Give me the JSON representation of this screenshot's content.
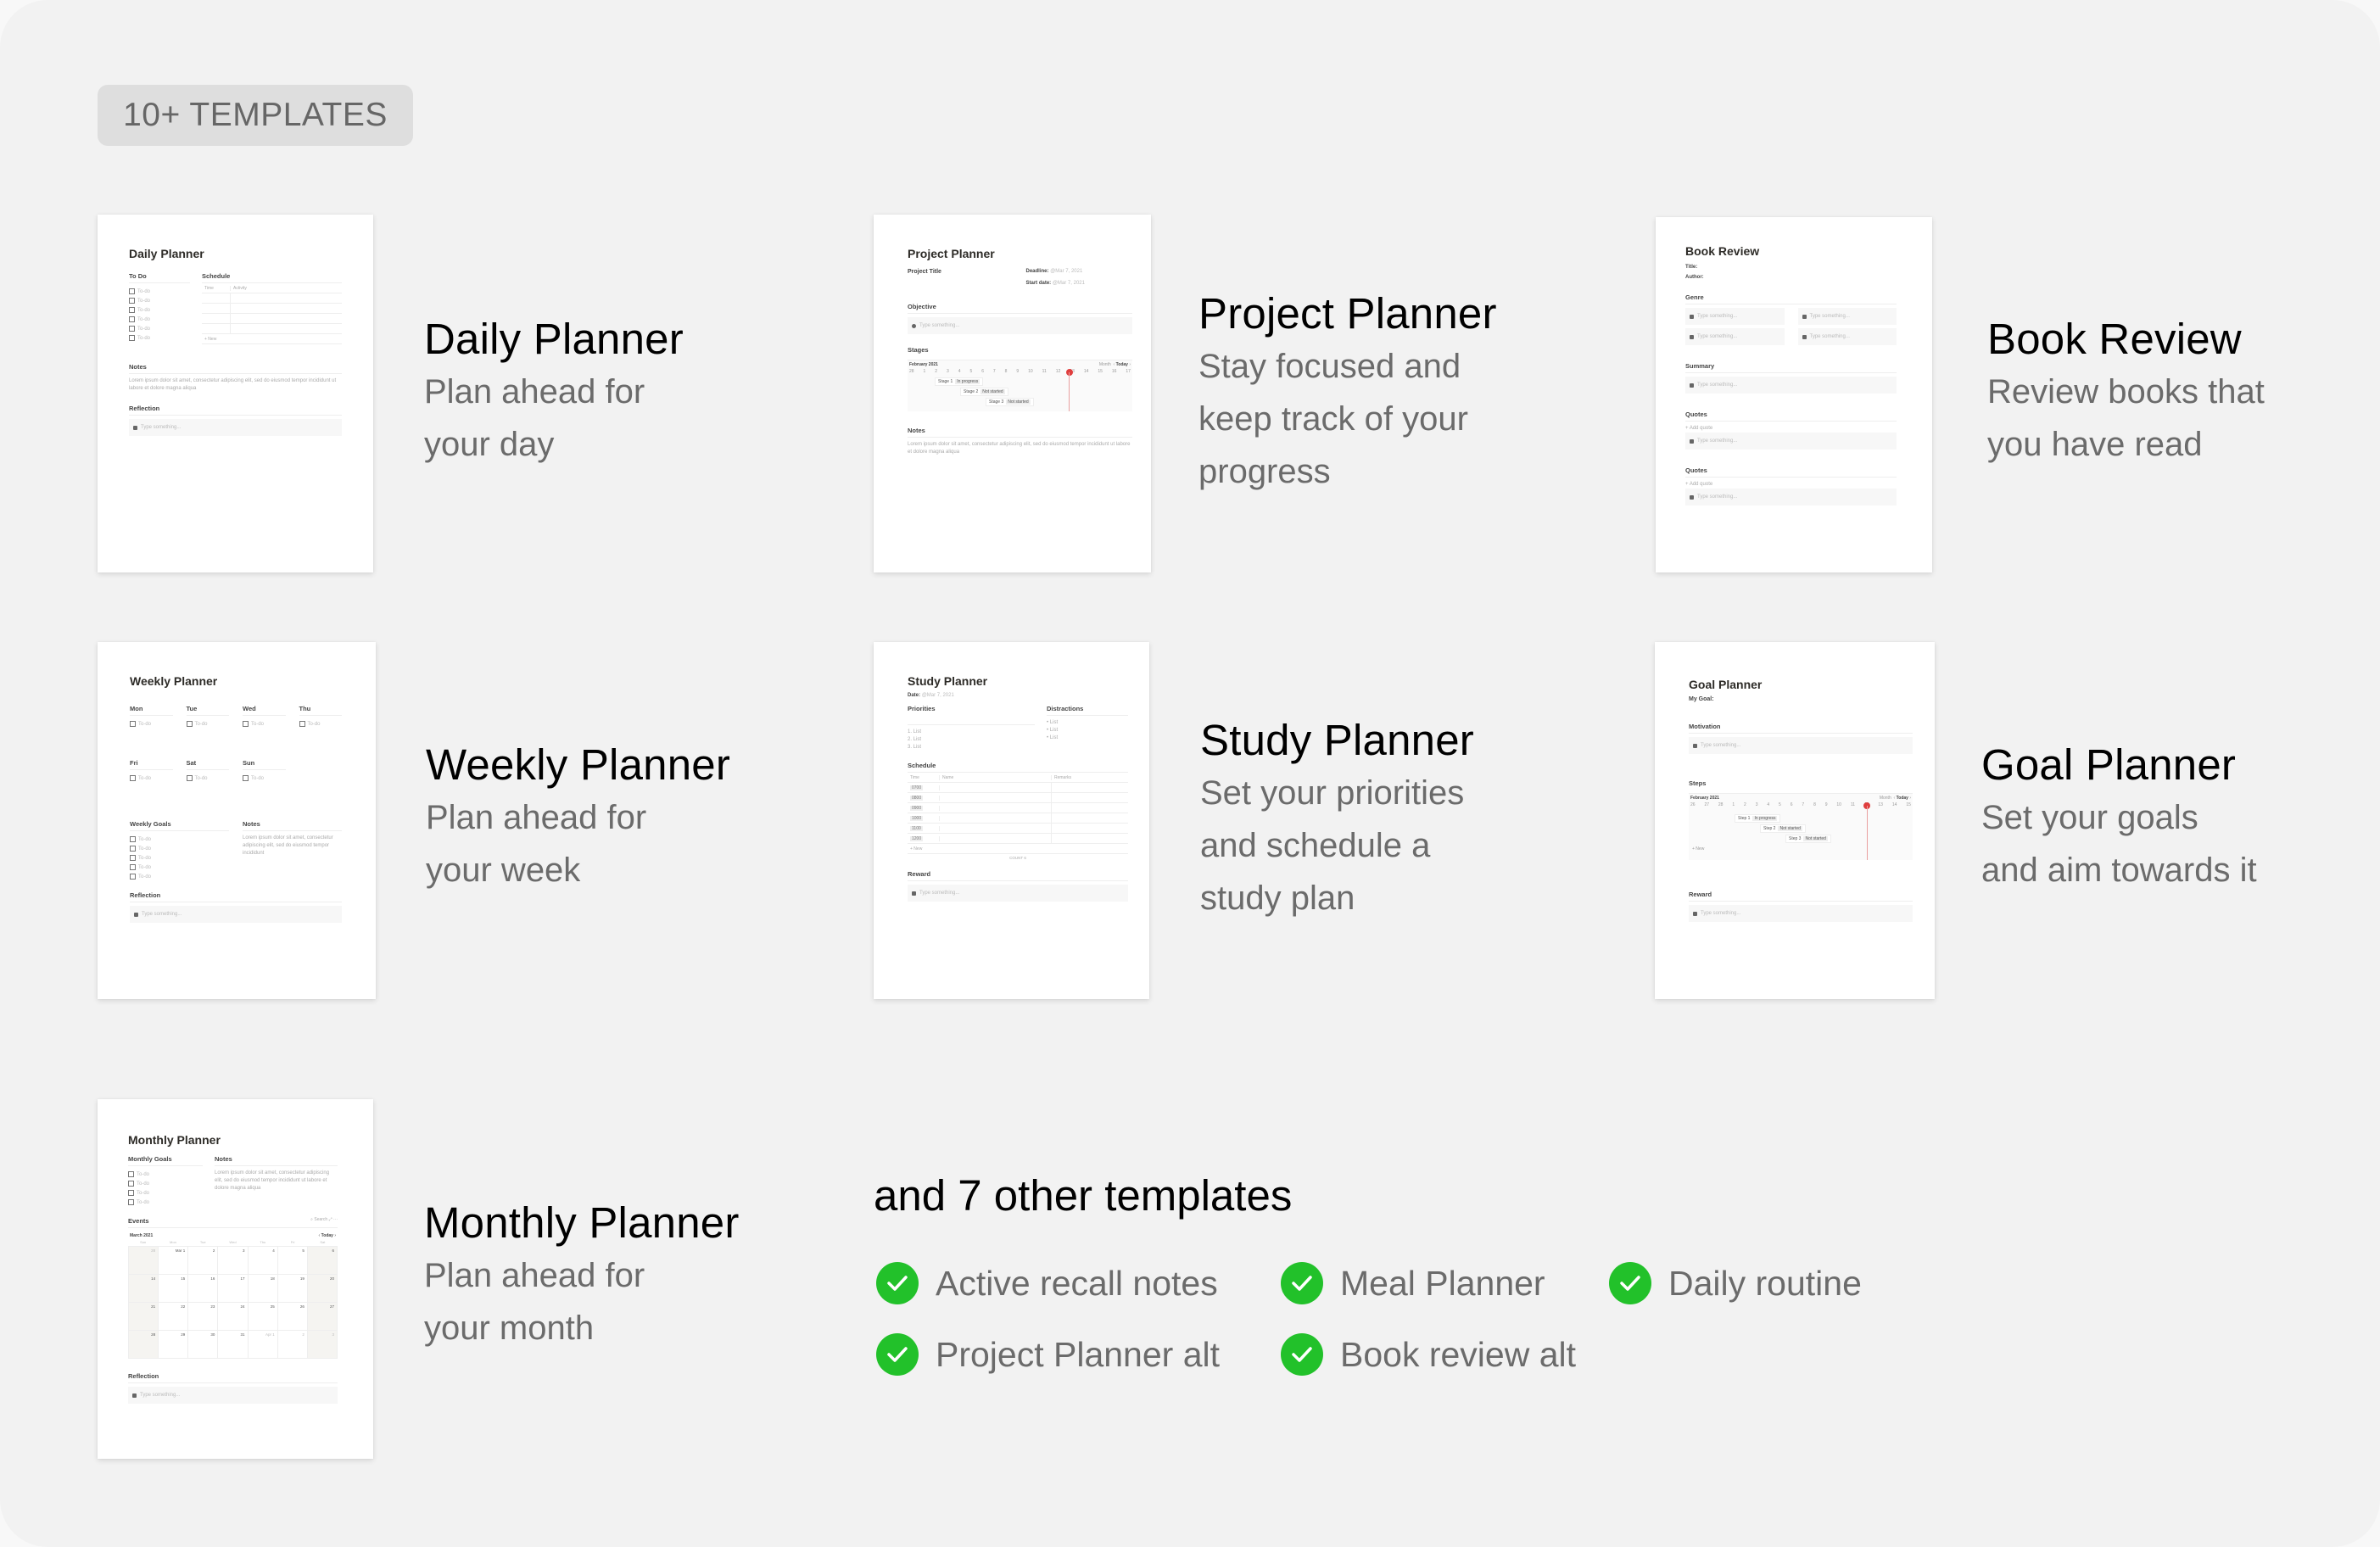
{
  "badge": "10+ TEMPLATES",
  "accent_color": "#22c12a",
  "templates": [
    {
      "title": "Daily Planner",
      "subtitle_lines": [
        "Plan ahead for",
        "your day"
      ]
    },
    {
      "title": "Project Planner",
      "subtitle_lines": [
        "Stay focused and",
        "keep track of your",
        "progress"
      ]
    },
    {
      "title": "Book Review",
      "subtitle_lines": [
        "Review books that",
        "you have read"
      ]
    },
    {
      "title": "Weekly Planner",
      "subtitle_lines": [
        "Plan ahead for",
        "your week"
      ]
    },
    {
      "title": "Study Planner",
      "subtitle_lines": [
        "Set your priorities",
        "and schedule a",
        "study plan"
      ]
    },
    {
      "title": "Goal Planner",
      "subtitle_lines": [
        "Set your goals",
        "and aim towards it"
      ]
    },
    {
      "title": "Monthly Planner",
      "subtitle_lines": [
        "Plan ahead for",
        "your month"
      ]
    }
  ],
  "others": {
    "title": "and 7 other templates",
    "items": [
      "Active recall notes",
      "Meal Planner",
      "Daily routine",
      "Project Planner alt",
      "Book review alt"
    ]
  },
  "previews": {
    "common": {
      "todo": "To-do",
      "type_something": "Type something...",
      "lorem": "Lorem ipsum dolor sit amet, consectetur adipiscing elit, sed do eiusmod tempor incididunt ut labore et dolore magna aliqua",
      "new": "+ New",
      "list": "List",
      "notes": "Notes",
      "reflection": "Reflection",
      "reward": "Reward",
      "today": "Today",
      "month": "Month"
    },
    "daily": {
      "title": "Daily Planner",
      "todo_h": "To Do",
      "schedule_h": "Schedule",
      "time": "Time",
      "activity": "Activity"
    },
    "project": {
      "title": "Project Planner",
      "project_title": "Project Title",
      "deadline": "Deadline:",
      "start": "Start date:",
      "date": "@Mar 7, 2021",
      "objective": "Objective",
      "stages": "Stages",
      "month_label": "February 2021",
      "days": [
        "28",
        "1",
        "2",
        "3",
        "4",
        "5",
        "6",
        "7",
        "8",
        "9",
        "10",
        "11",
        "12",
        "13",
        "14",
        "15",
        "16",
        "17"
      ],
      "today_day": "12",
      "bars": [
        {
          "name": "Stage 1",
          "status": "In progress"
        },
        {
          "name": "Stage 2",
          "status": "Not started"
        },
        {
          "name": "Stage 3",
          "status": "Not started"
        }
      ]
    },
    "book": {
      "title": "Book Review",
      "title_f": "Title:",
      "author": "Author:",
      "genre": "Genre",
      "summary": "Summary",
      "quotes": "Quotes",
      "add_quote": "+ Add quote"
    },
    "weekly": {
      "title": "Weekly Planner",
      "days": [
        "Mon",
        "Tue",
        "Wed",
        "Thu",
        "Fri",
        "Sat",
        "Sun"
      ],
      "goals": "Weekly Goals",
      "notes_text": "Lorem ipsum dolor sit amet, consectetur adipiscing elit, sed do eiusmod tempor incididunt"
    },
    "study": {
      "title": "Study Planner",
      "date_label": "Date:",
      "date": "@Mar 7, 2021",
      "priorities": "Priorities",
      "distractions": "Distractions",
      "schedule": "Schedule",
      "cols": [
        "Time",
        "Name",
        "Remarks"
      ],
      "times": [
        "0700",
        "0800",
        "0900",
        "1000",
        "1100",
        "1200"
      ],
      "count": "COUNT 6"
    },
    "goal": {
      "title": "Goal Planner",
      "my_goal": "My Goal:",
      "motivation": "Motivation",
      "steps": "Steps",
      "month_label": "February 2021",
      "days": [
        "26",
        "27",
        "28",
        "1",
        "2",
        "3",
        "4",
        "5",
        "6",
        "7",
        "8",
        "9",
        "10",
        "11",
        "12",
        "13",
        "14",
        "15"
      ],
      "today_day": "12",
      "bars": [
        {
          "name": "Step 1",
          "status": "In progress"
        },
        {
          "name": "Step 2",
          "status": "Not started"
        },
        {
          "name": "Step 3",
          "status": "Not started"
        }
      ]
    },
    "monthly": {
      "title": "Monthly Planner",
      "goals": "Monthly Goals",
      "events": "Events",
      "search": "Search",
      "month_label": "March 2021",
      "weekdays": [
        "Sun",
        "Mon",
        "Tue",
        "Wed",
        "Thu",
        "Fri",
        "Sat"
      ],
      "cells": [
        "28",
        "Mar 1",
        "2",
        "3",
        "4",
        "5",
        "6",
        "14",
        "15",
        "16",
        "17",
        "18",
        "19",
        "20",
        "21",
        "22",
        "23",
        "24",
        "25",
        "26",
        "27",
        "28",
        "29",
        "30",
        "31",
        "Apr 1",
        "2",
        "3"
      ]
    }
  }
}
